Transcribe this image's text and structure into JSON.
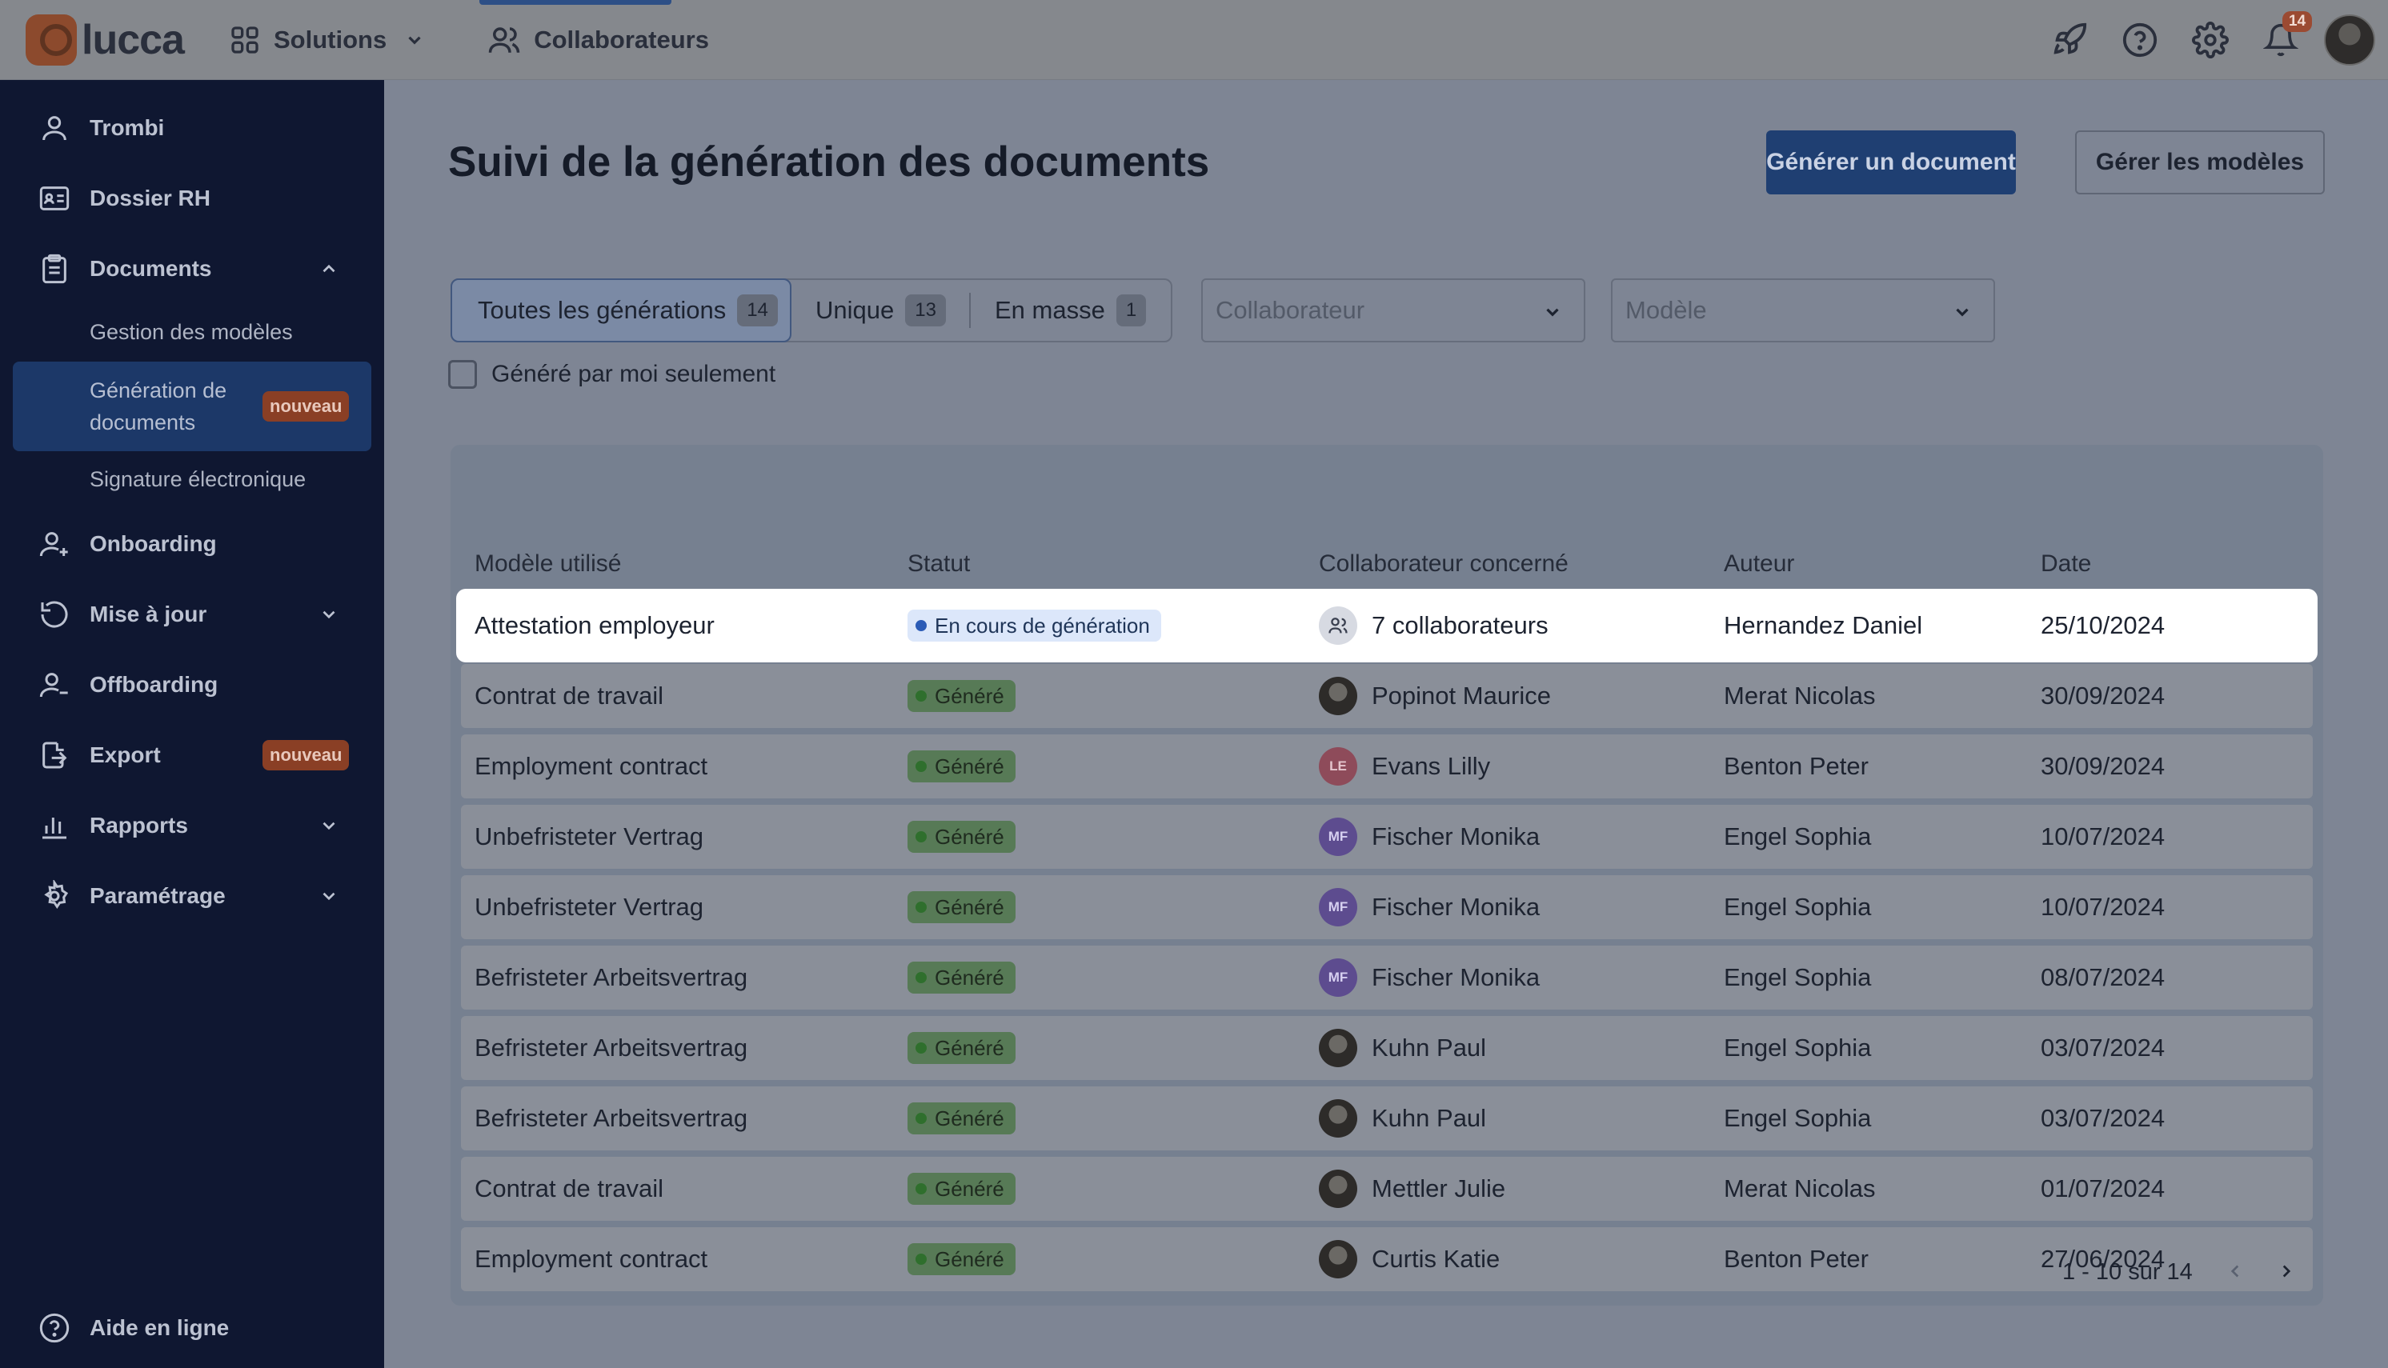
{
  "topbar": {
    "logo_text": "lucca",
    "solutions_label": "Solutions",
    "collaborateurs_label": "Collaborateurs",
    "notification_count": "14",
    "icons": [
      "rocket-icon",
      "help-icon",
      "gear-icon",
      "bell-icon"
    ]
  },
  "sidebar": {
    "items": [
      {
        "label": "Trombi",
        "icon": "user-icon"
      },
      {
        "label": "Dossier RH",
        "icon": "id-card-icon"
      },
      {
        "label": "Documents",
        "icon": "clipboard-icon"
      },
      {
        "label": "Onboarding",
        "icon": "user-plus-icon"
      },
      {
        "label": "Mise à jour",
        "icon": "refresh-icon"
      },
      {
        "label": "Offboarding",
        "icon": "user-minus-icon"
      },
      {
        "label": "Export",
        "icon": "export-icon"
      },
      {
        "label": "Rapports",
        "icon": "chart-icon"
      },
      {
        "label": "Paramétrage",
        "icon": "gear-icon"
      }
    ],
    "subitems": {
      "gestion": "Gestion des modèles",
      "generation": "Génération de documents",
      "signature": "Signature électronique"
    },
    "new_badge": "nouveau",
    "help_label": "Aide en ligne"
  },
  "main": {
    "title": "Suivi de la génération des documents",
    "generate_button": "Générer un document",
    "manage_button": "Gérer les modèles",
    "tabs": [
      {
        "label": "Toutes les générations",
        "count": "14"
      },
      {
        "label": "Unique",
        "count": "13"
      },
      {
        "label": "En masse",
        "count": "1"
      }
    ],
    "collaborateur_placeholder": "Collaborateur",
    "modele_placeholder": "Modèle",
    "checkbox_label": "Généré par moi seulement",
    "table": {
      "columns": [
        "Modèle utilisé",
        "Statut",
        "Collaborateur concerné",
        "Auteur",
        "Date"
      ],
      "rows": [
        {
          "model": "Attestation employeur",
          "status": "En cours de génération",
          "status_type": "progress",
          "collab": "7 collaborateurs",
          "avatar": "group",
          "initials": "",
          "author": "Hernandez Daniel",
          "date": "25/10/2024"
        },
        {
          "model": "Contrat de travail",
          "status": "Généré",
          "status_type": "done",
          "collab": "Popinot Maurice",
          "avatar": "photo",
          "initials": "",
          "author": "Merat Nicolas",
          "date": "30/09/2024"
        },
        {
          "model": "Employment contract",
          "status": "Généré",
          "status_type": "done",
          "collab": "Evans Lilly",
          "avatar": "le",
          "initials": "LE",
          "author": "Benton Peter",
          "date": "30/09/2024"
        },
        {
          "model": "Unbefristeter Vertrag",
          "status": "Généré",
          "status_type": "done",
          "collab": "Fischer Monika",
          "avatar": "mf",
          "initials": "MF",
          "author": "Engel Sophia",
          "date": "10/07/2024"
        },
        {
          "model": "Unbefristeter Vertrag",
          "status": "Généré",
          "status_type": "done",
          "collab": "Fischer Monika",
          "avatar": "mf",
          "initials": "MF",
          "author": "Engel Sophia",
          "date": "10/07/2024"
        },
        {
          "model": "Befristeter Arbeitsvertrag",
          "status": "Généré",
          "status_type": "done",
          "collab": "Fischer Monika",
          "avatar": "mf",
          "initials": "MF",
          "author": "Engel Sophia",
          "date": "08/07/2024"
        },
        {
          "model": "Befristeter Arbeitsvertrag",
          "status": "Généré",
          "status_type": "done",
          "collab": "Kuhn Paul",
          "avatar": "photo",
          "initials": "",
          "author": "Engel Sophia",
          "date": "03/07/2024"
        },
        {
          "model": "Befristeter Arbeitsvertrag",
          "status": "Généré",
          "status_type": "done",
          "collab": "Kuhn Paul",
          "avatar": "photo",
          "initials": "",
          "author": "Engel Sophia",
          "date": "03/07/2024"
        },
        {
          "model": "Contrat de travail",
          "status": "Généré",
          "status_type": "done",
          "collab": "Mettler Julie",
          "avatar": "photo",
          "initials": "",
          "author": "Merat Nicolas",
          "date": "01/07/2024"
        },
        {
          "model": "Employment contract",
          "status": "Généré",
          "status_type": "done",
          "collab": "Curtis Katie",
          "avatar": "photo",
          "initials": "",
          "author": "Benton Peter",
          "date": "27/06/2024"
        }
      ]
    },
    "pagination": "1 - 10 sur 14"
  },
  "colors": {
    "sidebar_bg": "#0f1731",
    "primary": "#1f3f72",
    "new_badge": "#8a3f25",
    "status_done": "#577a56",
    "status_progress": "#dce7fa"
  }
}
